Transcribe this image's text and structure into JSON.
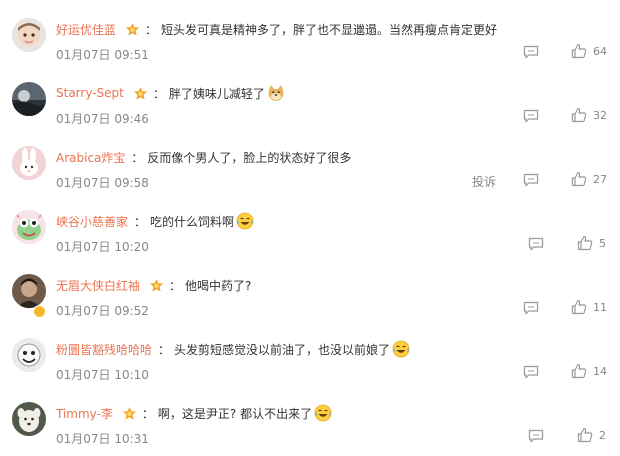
{
  "icons": {
    "reply": "comment-bubble-icon",
    "like": "thumbs-up-icon",
    "medal": "fan-medal-icon",
    "verified": "verified-badge-icon"
  },
  "colors": {
    "username": "#eb7350",
    "meta": "#888888",
    "text": "#333333",
    "medal": "#f4a62a"
  },
  "comments": [
    {
      "username": "好运优佳蓝",
      "text": "短头发可真是精神多了，胖了也不显邋遢。当然再瘦点肯定更好",
      "time": "01月07日 09:51",
      "likes": "64",
      "medal": true,
      "emoji": null
    },
    {
      "username": "Starry-Sept",
      "text": "胖了姨味儿减轻了",
      "time": "01月07日 09:46",
      "likes": "32",
      "medal": true,
      "emoji": "doge"
    },
    {
      "username": "Arabica炸宝",
      "text": "反而像个男人了，脸上的状态好了很多",
      "time": "01月07日 09:58",
      "likes": "27",
      "medal": false,
      "emoji": null,
      "report": "投诉"
    },
    {
      "username": "峡谷小慈善家",
      "text": "吃的什么饲料啊",
      "time": "01月07日 10:20",
      "likes": "5",
      "medal": false,
      "emoji": "laugh-cry"
    },
    {
      "username": "无眉大侠白红袖",
      "text": "他喝中药了?",
      "time": "01月07日 09:52",
      "likes": "11",
      "medal": true,
      "emoji": null,
      "verified": true
    },
    {
      "username": "粉圜皆豁残哈哈哈",
      "text": "头发剪短感觉没以前油了，也没以前娘了",
      "time": "01月07日 10:10",
      "likes": "14",
      "medal": false,
      "emoji": "laugh-cry"
    },
    {
      "username": "Timmy-李",
      "text": "啊，这是尹正? 都认不出来了",
      "time": "01月07日 10:31",
      "likes": "2",
      "medal": true,
      "emoji": "laugh-cry"
    }
  ]
}
